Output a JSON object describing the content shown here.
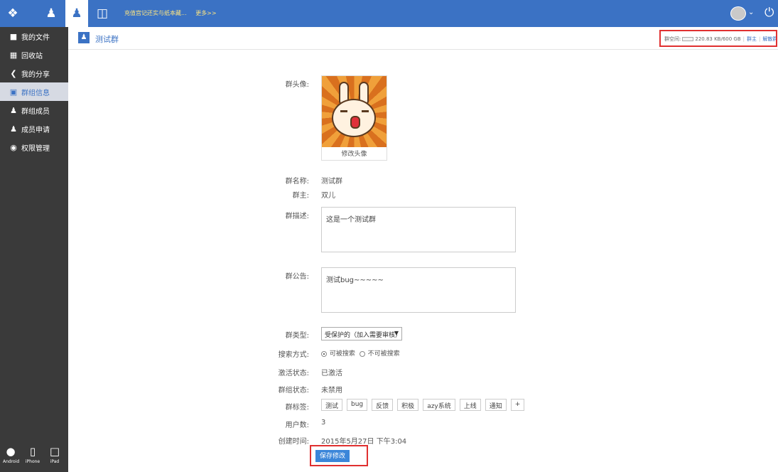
{
  "topbar": {
    "notice": "充值宫记还实与纸本藏...",
    "more": "更多>>",
    "icons": [
      "app-logo-icon",
      "user-icon",
      "group-icon",
      "box-icon",
      "avatar",
      "power-icon"
    ]
  },
  "sidebar": {
    "items": [
      {
        "label": "我的文件",
        "icon": "folder-icon"
      },
      {
        "label": "回收站",
        "icon": "trash-icon"
      },
      {
        "label": "我的分享",
        "icon": "share-icon"
      },
      {
        "label": "群组信息",
        "icon": "group-info-icon"
      },
      {
        "label": "群组成员",
        "icon": "members-icon"
      },
      {
        "label": "成员申请",
        "icon": "apply-icon"
      },
      {
        "label": "权限管理",
        "icon": "lock-icon"
      }
    ],
    "devices": [
      "Android",
      "iPhone",
      "iPad"
    ]
  },
  "header": {
    "group_name": "测试群",
    "space_label": "群空间:",
    "space_value": "220.83 KB/600 GB",
    "owner_link": "群主",
    "dissolve_link": "解散群"
  },
  "form": {
    "avatar_label": "群头像:",
    "change_avatar": "修改头像",
    "name_label": "群名称:",
    "name_value": "测试群",
    "owner_label": "群主:",
    "owner_value": "双儿",
    "desc_label": "群描述:",
    "desc_value": "这是一个测试群",
    "notice_label": "群公告:",
    "notice_value": "测试bug~~~~~",
    "type_label": "群类型:",
    "type_value": "受保护的（加入需要审核）",
    "search_label": "搜索方式:",
    "search_on": "可被搜索",
    "search_off": "不可被搜索",
    "activate_label": "激活状态:",
    "activate_value": "已激活",
    "status_label": "群组状态:",
    "status_value": "未禁用",
    "tags_label": "群标签:",
    "tags": [
      "测试",
      "bug",
      "反馈",
      "积极",
      "azy系统",
      "上线",
      "通知",
      "+"
    ],
    "users_label": "用户数:",
    "users_value": "3",
    "created_label": "创建时间:",
    "created_value": "2015年5月27日 下午3:04",
    "save_button": "保存修改"
  },
  "colors": {
    "primary": "#3b72c4",
    "sidebar": "#3a3a3a",
    "highlight": "#e03030"
  }
}
